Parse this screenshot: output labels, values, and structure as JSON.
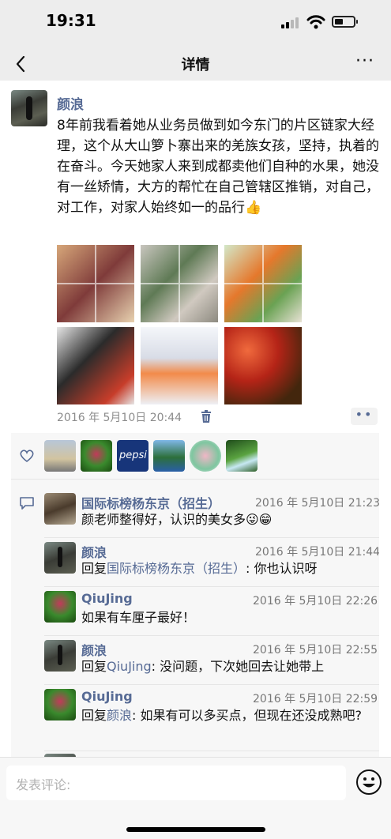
{
  "status": {
    "time": "19:31"
  },
  "nav": {
    "title": "详情",
    "more": "···"
  },
  "post": {
    "author": "颜浪",
    "text": "8年前我看着她从业务员做到如今东门的片区链家大经理，这个从大山箩卜寨出来的羌族女孩，坚持，执着的在奋斗。今天她家人来到成都卖他们自种的水果，她没有一丝矫情，大方的帮忙在自己管辖区推销，对自己，对工作，对家人始终如一的品行",
    "emoji": "👍",
    "time": "2016 年 5月10日 20:44",
    "action_dots": "••"
  },
  "likes": {
    "avatar_label_pepsi": "pepsi"
  },
  "comments": [
    {
      "name": "国际标榜杨东京（招生）",
      "time": "2016 年 5月10日 21:23",
      "text": "颜老师整得好，认识的美女多😜😁"
    },
    {
      "name": "颜浪",
      "time": "2016 年 5月10日 21:44",
      "reply_prefix": "回复",
      "reply_to": "国际标榜杨东京（招生）",
      "reply_text": ": 你也认识呀"
    },
    {
      "name": "QiuJing",
      "time": "2016 年 5月10日 22:26",
      "text": "如果有车厘子最好！"
    },
    {
      "name": "颜浪",
      "time": "2016 年 5月10日 22:55",
      "reply_prefix": "回复",
      "reply_to": "QiuJing",
      "reply_text": ": 没问题，下次她回去让她带上"
    },
    {
      "name": "QiuJing",
      "time": "2016 年 5月10日 22:59",
      "reply_prefix": "回复",
      "reply_to": "颜浪",
      "reply_text": ": 如果有可以多买点，但现在还没成熟吧?"
    }
  ],
  "input": {
    "placeholder": "发表评论:"
  }
}
